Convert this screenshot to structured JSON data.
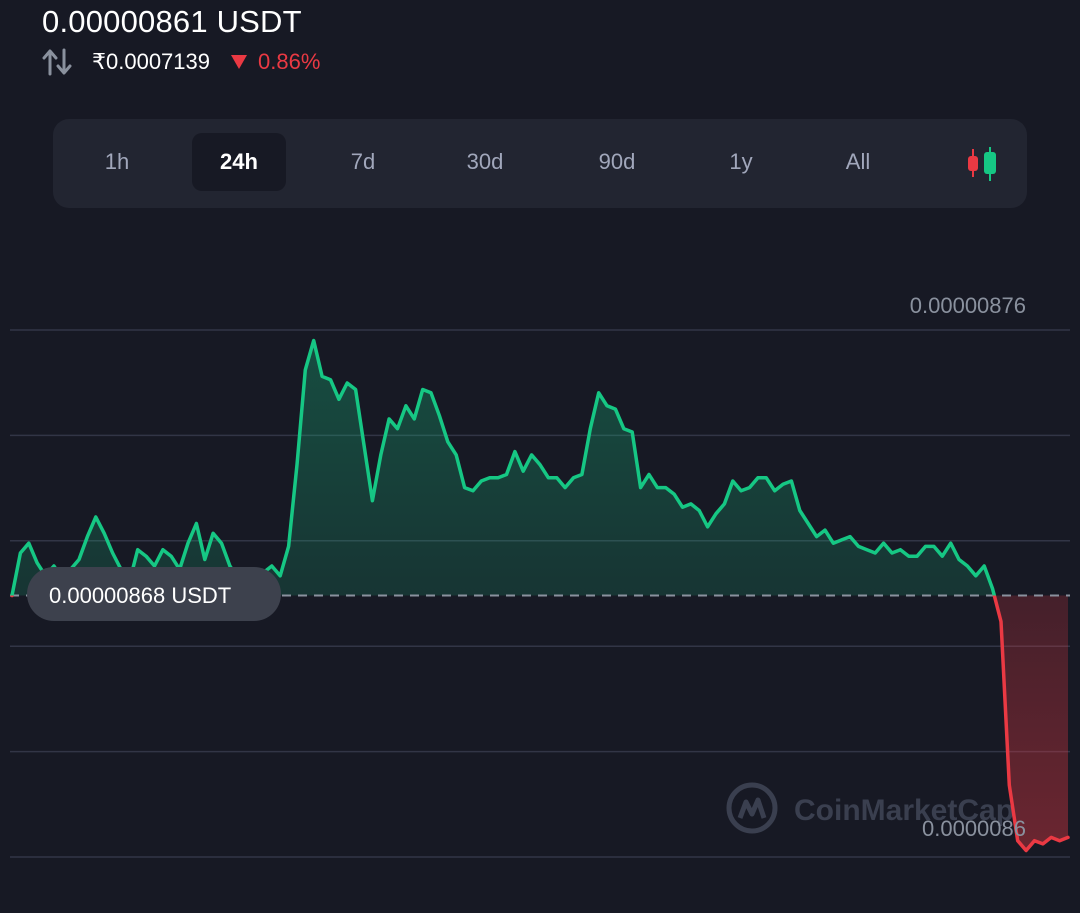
{
  "header": {
    "price": "0.00000861 USDT",
    "fiat_price": "₹0.0007139",
    "change": "0.86%",
    "change_color": "#ea3943",
    "swap_icon": "swap-arrows-icon",
    "change_icon": "down-triangle-icon"
  },
  "ranges": {
    "tabs": [
      "1h",
      "24h",
      "7d",
      "30d",
      "90d",
      "1y",
      "All"
    ],
    "active": "24h",
    "chart_type_icon": "candlestick-icon"
  },
  "colors": {
    "up": "#16c784",
    "down": "#ea3943",
    "background": "#171924",
    "panel": "#222531"
  },
  "watermark": {
    "text": "CoinMarketCap",
    "icon": "coinmarketcap-logo-icon"
  },
  "chart_data": {
    "type": "line",
    "period": "24h",
    "yaxis_labels": [
      "0.00000876",
      "0.0000086"
    ],
    "ylim": [
      8.6e-06,
      8.7612e-06
    ],
    "reference_label": "0.00000868 USDT",
    "reference_value": 8.68e-06,
    "up_color": "#16c784",
    "down_color": "#ea3943",
    "grid": true,
    "series": [
      {
        "values": [
          8.68e-06,
          8.693e-06,
          8.696e-06,
          8.69e-06,
          8.686e-06,
          8.689e-06,
          8.685e-06,
          8.688e-06,
          8.691e-06,
          8.698e-06,
          8.704e-06,
          8.699e-06,
          8.693e-06,
          8.688e-06,
          8.684e-06,
          8.694e-06,
          8.692e-06,
          8.689e-06,
          8.694e-06,
          8.692e-06,
          8.688e-06,
          8.696e-06,
          8.702e-06,
          8.691e-06,
          8.699e-06,
          8.696e-06,
          8.689e-06,
          8.685e-06,
          8.687e-06,
          8.684e-06,
          8.687e-06,
          8.689e-06,
          8.686e-06,
          8.695e-06,
          8.72e-06,
          8.749e-06,
          8.758e-06,
          8.747e-06,
          8.746e-06,
          8.74e-06,
          8.745e-06,
          8.743e-06,
          8.726e-06,
          8.709e-06,
          8.723e-06,
          8.734e-06,
          8.731e-06,
          8.738e-06,
          8.734e-06,
          8.743e-06,
          8.742e-06,
          8.735e-06,
          8.727e-06,
          8.723e-06,
          8.713e-06,
          8.712e-06,
          8.715e-06,
          8.716e-06,
          8.716e-06,
          8.717e-06,
          8.724e-06,
          8.718e-06,
          8.723e-06,
          8.72e-06,
          8.716e-06,
          8.716e-06,
          8.713e-06,
          8.716e-06,
          8.717e-06,
          8.731e-06,
          8.742e-06,
          8.738e-06,
          8.737e-06,
          8.731e-06,
          8.73e-06,
          8.713e-06,
          8.717e-06,
          8.713e-06,
          8.713e-06,
          8.711e-06,
          8.707e-06,
          8.708e-06,
          8.706e-06,
          8.701e-06,
          8.705e-06,
          8.708e-06,
          8.715e-06,
          8.712e-06,
          8.713e-06,
          8.716e-06,
          8.716e-06,
          8.712e-06,
          8.714e-06,
          8.715e-06,
          8.706e-06,
          8.702e-06,
          8.698e-06,
          8.7e-06,
          8.696e-06,
          8.697e-06,
          8.698e-06,
          8.695e-06,
          8.694e-06,
          8.693e-06,
          8.696e-06,
          8.693e-06,
          8.694e-06,
          8.692e-06,
          8.692e-06,
          8.695e-06,
          8.695e-06,
          8.692e-06,
          8.696e-06,
          8.691e-06,
          8.689e-06,
          8.686e-06,
          8.689e-06,
          8.682e-06,
          8.672e-06,
          8.622e-06,
          8.605e-06,
          8.602e-06,
          8.605e-06,
          8.604e-06,
          8.606e-06,
          8.605e-06,
          8.606e-06
        ]
      }
    ]
  }
}
